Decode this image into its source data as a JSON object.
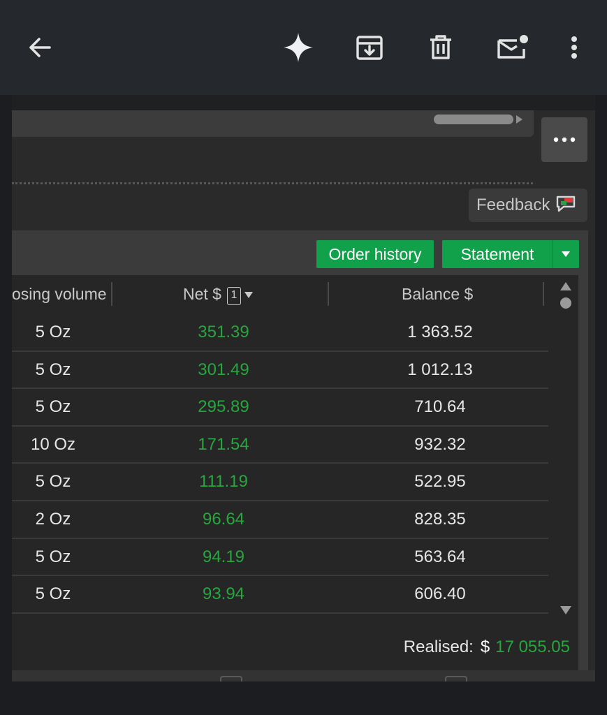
{
  "appbar": {
    "icons": [
      "back-arrow-icon",
      "sparkle-icon",
      "archive-icon",
      "trash-icon",
      "mark-unread-icon",
      "more-vert-icon"
    ]
  },
  "screenshot": {
    "feedback_label": "Feedback",
    "buttons": {
      "order_history": "Order history",
      "statement": "Statement"
    },
    "table": {
      "headers": {
        "closing_volume": "osing volume",
        "net": "Net $",
        "net_badge": "1",
        "balance": "Balance $"
      },
      "rows": [
        {
          "volume": "5 Oz",
          "net": "351.39",
          "balance": "1 363.52"
        },
        {
          "volume": "5 Oz",
          "net": "301.49",
          "balance": "1 012.13"
        },
        {
          "volume": "5 Oz",
          "net": "295.89",
          "balance": "710.64"
        },
        {
          "volume": "10 Oz",
          "net": "171.54",
          "balance": "932.32"
        },
        {
          "volume": "5 Oz",
          "net": "111.19",
          "balance": "522.95"
        },
        {
          "volume": "2 Oz",
          "net": "96.64",
          "balance": "828.35"
        },
        {
          "volume": "5 Oz",
          "net": "94.19",
          "balance": "563.64"
        },
        {
          "volume": "5 Oz",
          "net": "93.94",
          "balance": "606.40"
        }
      ]
    },
    "realised": {
      "label": "Realised:",
      "currency": "$",
      "value": "17 055.05"
    },
    "colors": {
      "positive": "#27a63f",
      "button_green": "#11a14a"
    }
  }
}
